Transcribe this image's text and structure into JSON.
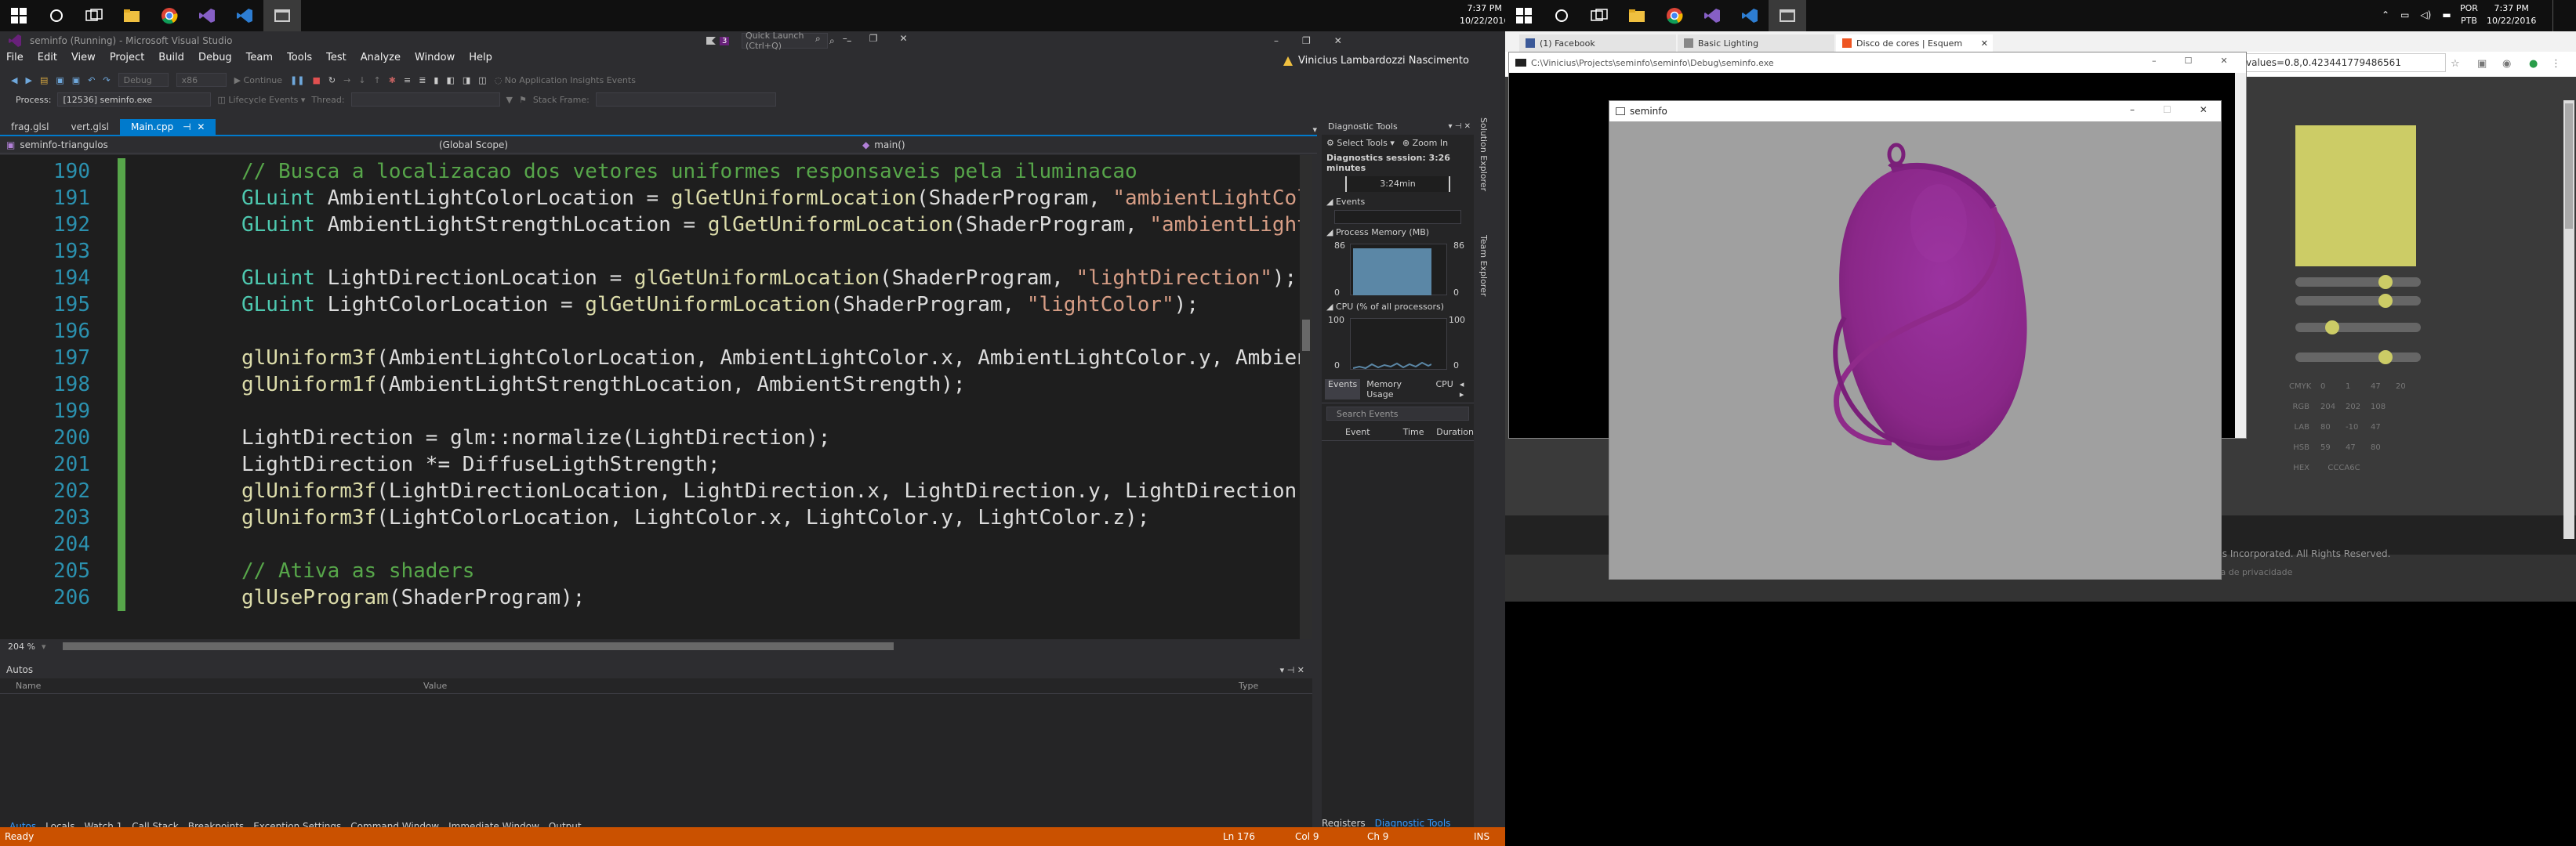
{
  "left_taskbar": {
    "clock": {
      "time": "7:37 PM",
      "date": "10/22/2016"
    }
  },
  "vs": {
    "title": "seminfo (Running) - Microsoft Visual Studio",
    "quick_launch_placeholder": "Quick Launch (Ctrl+Q)",
    "notif_count": "3",
    "user": "Vinicius Lambardozzi Nascimento",
    "menu": [
      "File",
      "Edit",
      "View",
      "Project",
      "Build",
      "Debug",
      "Team",
      "Tools",
      "Test",
      "Analyze",
      "Window",
      "Help"
    ],
    "toolbar": {
      "config": "Debug",
      "platform": "x86",
      "continue_label": "Continue",
      "insights": "No Application Insights Events"
    },
    "process_label": "Process:",
    "process_value": "[12536] seminfo.exe",
    "lifecycle": "Lifecycle Events",
    "thread_label": "Thread:",
    "stackframe_label": "Stack Frame:",
    "tabs": [
      "frag.glsl",
      "vert.glsl",
      "Main.cpp"
    ],
    "nav": {
      "project": "seminfo-triangulos",
      "scope": "(Global Scope)",
      "member": "main()"
    },
    "code": [
      {
        "n": "190",
        "parts": [
          [
            "cm",
            "// Busca a localizacao dos vetores uniformes responsaveis pela iluminacao"
          ]
        ]
      },
      {
        "n": "191",
        "parts": [
          [
            "kw",
            "GLuint"
          ],
          [
            "var",
            " AmbientLightColorLocation = "
          ],
          [
            "fn",
            "glGetUniformLocation"
          ],
          [
            "var",
            "(ShaderProgram, "
          ],
          [
            "str",
            "\"ambientLightColor\""
          ],
          [
            "var",
            ");"
          ]
        ]
      },
      {
        "n": "192",
        "parts": [
          [
            "kw",
            "GLuint"
          ],
          [
            "var",
            " AmbientLightStrengthLocation = "
          ],
          [
            "fn",
            "glGetUniformLocation"
          ],
          [
            "var",
            "(ShaderProgram, "
          ],
          [
            "str",
            "\"ambientLightStrength"
          ]
        ]
      },
      {
        "n": "193",
        "parts": []
      },
      {
        "n": "194",
        "parts": [
          [
            "kw",
            "GLuint"
          ],
          [
            "var",
            " LightDirectionLocation = "
          ],
          [
            "fn",
            "glGetUniformLocation"
          ],
          [
            "var",
            "(ShaderProgram, "
          ],
          [
            "str",
            "\"lightDirection\""
          ],
          [
            "var",
            ");"
          ]
        ]
      },
      {
        "n": "195",
        "parts": [
          [
            "kw",
            "GLuint"
          ],
          [
            "var",
            " LightColorLocation = "
          ],
          [
            "fn",
            "glGetUniformLocation"
          ],
          [
            "var",
            "(ShaderProgram, "
          ],
          [
            "str",
            "\"lightColor\""
          ],
          [
            "var",
            ");"
          ]
        ]
      },
      {
        "n": "196",
        "parts": []
      },
      {
        "n": "197",
        "parts": [
          [
            "fn",
            "glUniform3f"
          ],
          [
            "var",
            "(AmbientLightColorLocation, AmbientLightColor.x, AmbientLightColor.y, AmbientLightC"
          ]
        ]
      },
      {
        "n": "198",
        "parts": [
          [
            "fn",
            "glUniform1f"
          ],
          [
            "var",
            "(AmbientLightStrengthLocation, AmbientStrength);"
          ]
        ]
      },
      {
        "n": "199",
        "parts": []
      },
      {
        "n": "200",
        "parts": [
          [
            "var",
            "LightDirection = glm::normalize(LightDirection);"
          ]
        ]
      },
      {
        "n": "201",
        "parts": [
          [
            "var",
            "LightDirection *= DiffuseLigthStrength;"
          ]
        ]
      },
      {
        "n": "202",
        "parts": [
          [
            "fn",
            "glUniform3f"
          ],
          [
            "var",
            "(LightDirectionLocation, LightDirection.x, LightDirection.y, LightDirection.z);"
          ]
        ]
      },
      {
        "n": "203",
        "parts": [
          [
            "fn",
            "glUniform3f"
          ],
          [
            "var",
            "(LightColorLocation, LightColor.x, LightColor.y, LightColor.z);"
          ]
        ]
      },
      {
        "n": "204",
        "parts": []
      },
      {
        "n": "205",
        "parts": [
          [
            "cm",
            "// Ativa as shaders"
          ]
        ]
      },
      {
        "n": "206",
        "parts": [
          [
            "fn",
            "glUseProgram"
          ],
          [
            "var",
            "(ShaderProgram);"
          ]
        ]
      }
    ],
    "zoom": "204 %",
    "autos": {
      "title": "Autos",
      "col_name": "Name",
      "col_value": "Value",
      "col_type": "Type"
    },
    "bottom_tabs": [
      "Autos",
      "Locals",
      "Watch 1",
      "Call Stack",
      "Breakpoints",
      "Exception Settings",
      "Command Window",
      "Immediate Window",
      "Output"
    ],
    "diag": {
      "title": "Diagnostic Tools",
      "select_tools": "Select Tools",
      "zoom_in": "Zoom In",
      "session": "Diagnostics session: 3:26 minutes",
      "timeline": "3:24min",
      "events_label": "Events",
      "memory_label": "Process Memory (MB)",
      "memory_max": "86",
      "memory_min": "0",
      "cpu_label": "CPU (% of all processors)",
      "cpu_max": "100",
      "cpu_min": "0",
      "tabs": [
        "Events",
        "Memory Usage",
        "CPU"
      ],
      "search_placeholder": "Search Events",
      "cols": [
        "Event",
        "Time",
        "Duration"
      ],
      "bottom": [
        "Registers",
        "Diagnostic Tools"
      ]
    },
    "side_tabs": [
      "Solution Explorer",
      "Team Explorer"
    ],
    "status": {
      "ready": "Ready",
      "ln": "Ln 176",
      "col": "Col 9",
      "ch": "Ch 9",
      "ins": "INS"
    }
  },
  "right_taskbar": {
    "clock": {
      "time": "7:37 PM",
      "date": "10/22/2016"
    },
    "lang": "POR",
    "lang2": "PTB"
  },
  "chrome": {
    "tabs": [
      "(1) Facebook",
      "Basic Lighting",
      "Disco de cores | Esquem"
    ],
    "url_fragment": "values=0.8,0.423441779486561",
    "footer": "Systems Incorporated. All Rights Reserved.",
    "privacy": "Política de privacidade",
    "swatch_color": "#cccc66",
    "color_rows": [
      {
        "label": "CMYK",
        "values": [
          "0",
          "1",
          "47",
          "20"
        ]
      },
      {
        "label": "RGB",
        "values": [
          "204",
          "202",
          "108"
        ]
      },
      {
        "label": "LAB",
        "values": [
          "80",
          "-10",
          "47"
        ]
      },
      {
        "label": "HSB",
        "values": [
          "59",
          "47",
          "80"
        ]
      }
    ],
    "hex_label": "HEX",
    "hex_value": "CCCA6C"
  },
  "console": {
    "title": "C:\\Vinicius\\Projects\\seminfo\\seminfo\\Debug\\seminfo.exe"
  },
  "glwindow": {
    "title": "seminfo",
    "object_color": "#8f2a8a",
    "background": "#a0a0a0"
  }
}
